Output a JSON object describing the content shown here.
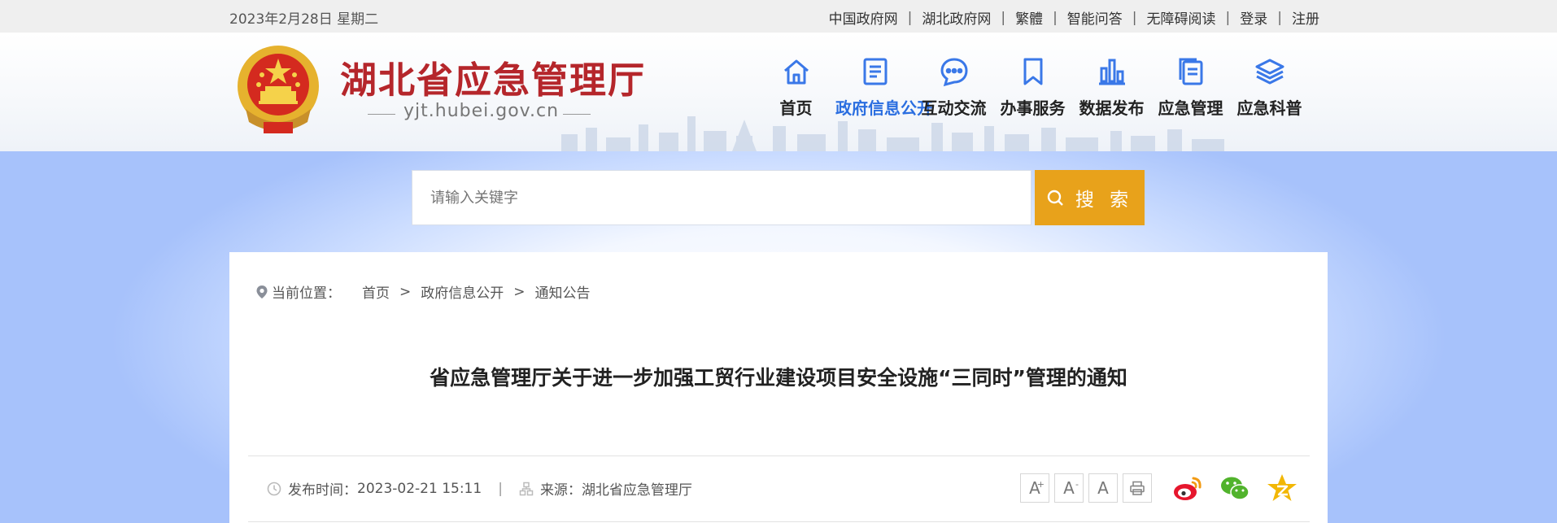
{
  "topbar": {
    "date": "2023年2月28日 星期二",
    "links": [
      "中国政府网",
      "湖北政府网",
      "繁體",
      "智能问答",
      "无障碍阅读",
      "登录",
      "注册"
    ],
    "separator": "|"
  },
  "header": {
    "title": "湖北省应急管理厅",
    "url": "yjt.hubei.gov.cn",
    "brand_color": "#b5262b",
    "nav": [
      {
        "label": "首页",
        "icon": "home-icon"
      },
      {
        "label": "政府信息公开",
        "icon": "document-icon",
        "active": true
      },
      {
        "label": "互动交流",
        "icon": "chat-icon"
      },
      {
        "label": "办事服务",
        "icon": "bookmark-icon"
      },
      {
        "label": "数据发布",
        "icon": "bar-chart-icon"
      },
      {
        "label": "应急管理",
        "icon": "files-icon"
      },
      {
        "label": "应急科普",
        "icon": "layers-icon"
      }
    ],
    "accent_color": "#2b6ee0"
  },
  "search": {
    "placeholder": "请输入关键字",
    "button_label": "搜 索",
    "button_color": "#e8a21b"
  },
  "breadcrumb": {
    "label": "当前位置：",
    "items": [
      "首页",
      "政府信息公开",
      "通知公告"
    ],
    "separator": ">"
  },
  "article": {
    "title": "省应急管理厅关于进一步加强工贸行业建设项目安全设施“三同时”管理的通知",
    "publish_label": "发布时间：",
    "publish_time": "2023-02-21 15:11",
    "separator": "|",
    "source_label": "来源：",
    "source": "湖北省应急管理厅"
  },
  "tools": {
    "font_buttons": [
      "A",
      "A",
      "A"
    ],
    "font_marks": [
      "+",
      "-",
      ""
    ],
    "share": [
      "weibo-icon",
      "wechat-icon",
      "qzone-icon"
    ]
  }
}
